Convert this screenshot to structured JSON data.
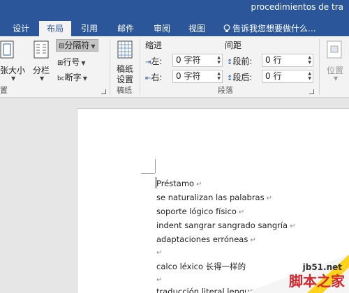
{
  "window": {
    "title": "procedimientos de tra"
  },
  "tabs": [
    {
      "label": "设计"
    },
    {
      "label": "布局"
    },
    {
      "label": "引用"
    },
    {
      "label": "邮件"
    },
    {
      "label": "审阅"
    },
    {
      "label": "视图"
    }
  ],
  "tell_me": {
    "placeholder": "告诉我您想要做什么..."
  },
  "ribbon": {
    "page_setup": {
      "paper_size": "张大小",
      "columns": "分栏",
      "breaks": "分隔符",
      "line_numbers": "行号",
      "hyphenation": "断字",
      "group_label": "置"
    },
    "draft_paper": {
      "button": "稿纸设置",
      "button_line1": "稿纸",
      "button_line2": "设置",
      "group_label": "稿纸"
    },
    "paragraph": {
      "indent_title": "缩进",
      "spacing_title": "间距",
      "left_label": "左:",
      "right_label": "右:",
      "before_label": "段前:",
      "after_label": "段后:",
      "left_value": "0 字符",
      "right_value": "0 字符",
      "before_value": "0 行",
      "after_value": "0 行",
      "group_label": "段落"
    },
    "arrange": {
      "position": "位置"
    }
  },
  "document": {
    "lines": [
      "Préstamo",
      "se naturalizan las palabras",
      "soporte lógico físico",
      "indent sangrar sangrado sangría",
      "adaptaciones erróneas",
      "",
      "calco léxico  长得一样的",
      "",
      "traducción literal lengua"
    ],
    "paragraph_mark": "↵"
  },
  "watermark": {
    "site": "jb51.net",
    "brand": "脚本之家"
  },
  "colors": {
    "ribbon_blue": "#2b579a",
    "ribbon_bg": "#f3f3f3",
    "workspace": "#e6e6e6"
  }
}
